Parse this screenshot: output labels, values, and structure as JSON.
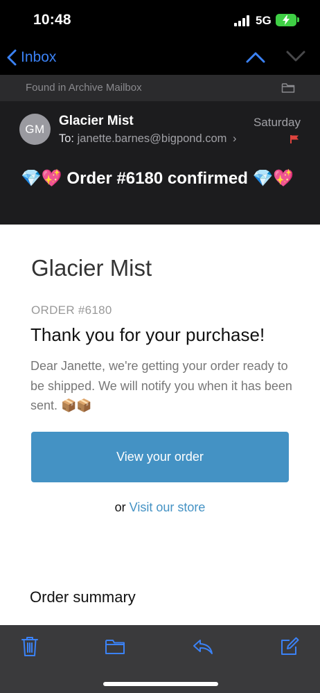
{
  "status_bar": {
    "time": "10:48",
    "network": "5G",
    "battery_state": "charging",
    "battery_color": "#3fcf45"
  },
  "nav": {
    "back_label": "Inbox",
    "accent": "#3b82f6",
    "icons": [
      "chevron-left-icon",
      "chevron-up-icon",
      "chevron-down-icon"
    ]
  },
  "archive_banner": {
    "text": "Found in Archive Mailbox",
    "icon": "folder-icon"
  },
  "header": {
    "avatar_initials": "GM",
    "sender": "Glacier Mist",
    "to_label": "To:",
    "recipient": "janette.barnes@bigpond.com",
    "recipient_chevron": "›",
    "date": "Saturday",
    "flag_color": "#e0443e",
    "subject": "💎💖 Order #6180 confirmed 💎💖"
  },
  "body": {
    "shop_name": "Glacier Mist",
    "order_number": "ORDER #6180",
    "thanks": "Thank you for your purchase!",
    "message": "Dear Janette, we're getting your order ready to be shipped. We will notify you when it has been sent. 📦📦",
    "view_button_label": "View your order",
    "button_color": "#4492c4",
    "store_prefix": "or",
    "store_link_label": "Visit our store",
    "summary_title": "Order summary"
  },
  "toolbar": {
    "icons": [
      "trash-icon",
      "folder-icon",
      "reply-icon",
      "compose-icon"
    ],
    "icon_color": "#3b82f6"
  }
}
